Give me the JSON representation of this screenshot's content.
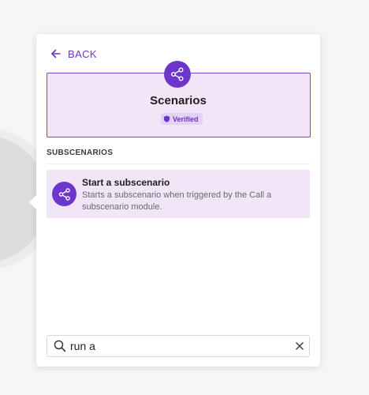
{
  "colors": {
    "accent": "#6d37cb",
    "accent_text": "#6d34c8",
    "card_bg": "#f0e6f7",
    "verified_bg": "#e3d2f3"
  },
  "nav": {
    "back_label": "BACK",
    "back_icon": "arrow-left-icon"
  },
  "app": {
    "icon": "share-icon",
    "title": "Scenarios",
    "badge_icon": "shield-icon",
    "badge_label": "Verified"
  },
  "section": {
    "title": "SUBSCENARIOS"
  },
  "modules": [
    {
      "icon": "share-icon",
      "title": "Start a subscenario",
      "description": "Starts a subscenario when triggered by the Call a subscenario module."
    }
  ],
  "search": {
    "icon": "search-icon",
    "value": "run a",
    "clear_icon": "close-icon"
  }
}
